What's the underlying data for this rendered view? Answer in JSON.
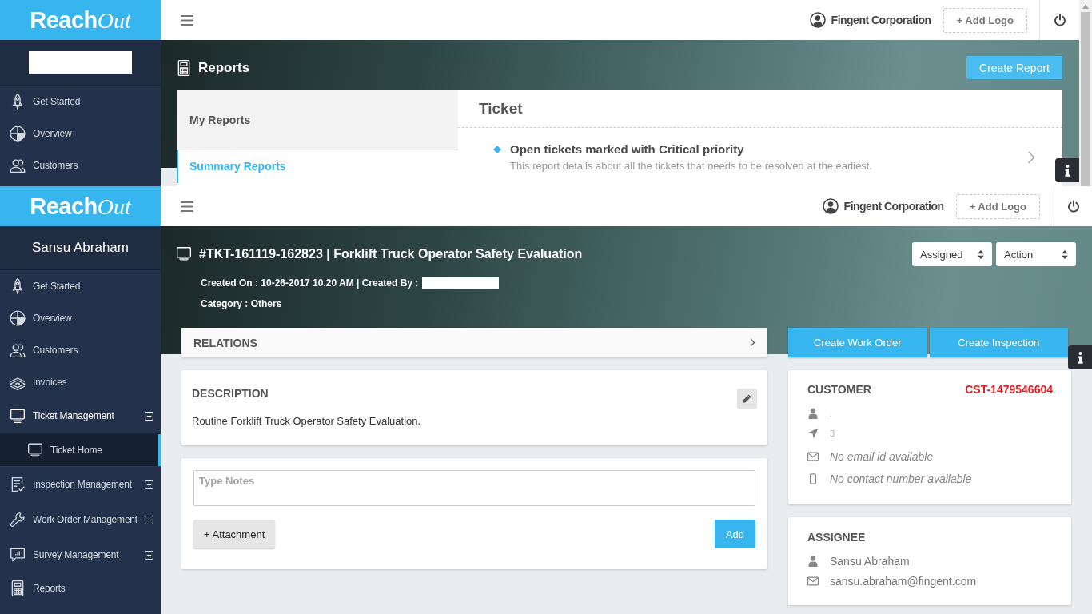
{
  "reports_screen": {
    "header": {
      "logo": {
        "bold": "Reach",
        "script": "Out"
      },
      "account": "Fingent Corporation",
      "add_logo": "+ Add Logo"
    },
    "sidebar": {
      "items": [
        {
          "kind": "link",
          "label": "Get Started",
          "selected": false
        },
        {
          "kind": "link",
          "label": "Overview",
          "selected": false
        },
        {
          "kind": "link",
          "label": "Customers",
          "selected": false
        }
      ]
    },
    "page": {
      "title": "Reports",
      "create_button": "Create Report",
      "report_nav": {
        "heading": "My Reports",
        "items": [
          {
            "label": "Summary Reports",
            "selected": true
          }
        ]
      },
      "section_title": "Ticket",
      "reports": [
        {
          "title": "Open tickets marked with Critical priority",
          "description": "This report details about all the tickets that needs to be resolved at the earliest."
        }
      ]
    }
  },
  "ticket_screen": {
    "header": {
      "logo": {
        "bold": "Reach",
        "script": "Out"
      },
      "account": "Fingent Corporation",
      "add_logo": "+ Add Logo"
    },
    "sidebar": {
      "user_name": "Sansu Abraham",
      "items": [
        {
          "kind": "link",
          "label": "Get Started",
          "selected": false
        },
        {
          "kind": "link",
          "label": "Overview",
          "selected": false
        },
        {
          "kind": "link",
          "label": "Customers",
          "selected": false
        },
        {
          "kind": "link",
          "label": "Invoices",
          "selected": false
        },
        {
          "kind": "group",
          "label": "Ticket Management",
          "expanded": true,
          "selected": false,
          "children": [
            {
              "kind": "link",
              "label": "Ticket Home",
              "selected": true
            }
          ]
        },
        {
          "kind": "group",
          "label": "Inspection Management",
          "expanded": false,
          "selected": false
        },
        {
          "kind": "group",
          "label": "Work Order Management",
          "expanded": false,
          "selected": false
        },
        {
          "kind": "group",
          "label": "Survey Management",
          "expanded": false,
          "selected": false
        },
        {
          "kind": "link",
          "label": "Reports",
          "selected": false
        }
      ]
    },
    "ticket": {
      "title": "#TKT-161119-162823 | Forklift Truck Operator Safety Evaluation",
      "created": "Created On : 10-26-2017 10.20 AM | Created By :",
      "category": "Category : Others",
      "status": "Assigned",
      "action": "Action"
    },
    "relations": "RELATIONS",
    "actions": [
      "Create Work Order",
      "Create Inspection"
    ],
    "description": {
      "heading": "DESCRIPTION",
      "text": "Routine Forklift Truck Operator Safety Evaluation."
    },
    "notes": {
      "placeholder": "Type Notes",
      "attachment_button": "+ Attachment",
      "add_button": "Add"
    },
    "customer": {
      "heading": "CUSTOMER",
      "id": "CST-1479546604",
      "name": ".",
      "address": "3",
      "email": {
        "value": "No email id available",
        "available": false
      },
      "phone": {
        "value": "No contact number available",
        "available": false
      }
    },
    "assignee": {
      "heading": "ASSIGNEE",
      "name": "Sansu Abraham",
      "email": {
        "value": "sansu.abraham@fingent.com",
        "available": true
      }
    }
  }
}
